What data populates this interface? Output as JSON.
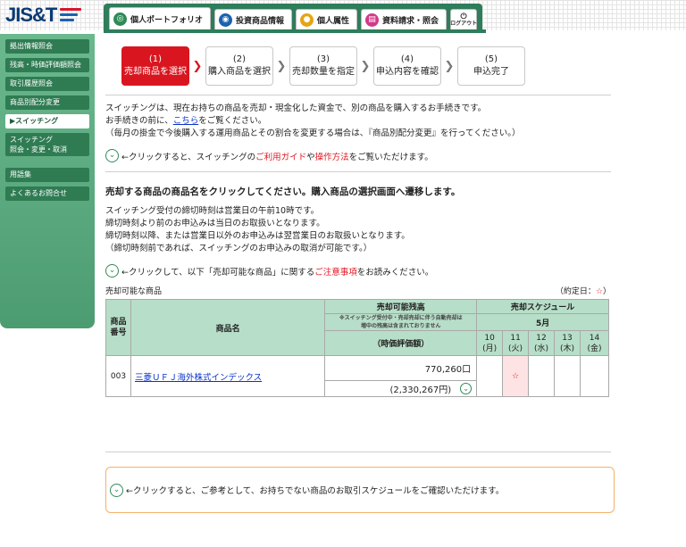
{
  "brand": {
    "logo_text": "JIS&T"
  },
  "tabs": [
    {
      "label": "個人ポートフォリオ",
      "icon": "portfolio-icon",
      "color": "#2e8b57",
      "active": true
    },
    {
      "label": "投資商品情報",
      "icon": "globe-icon",
      "color": "#1b62b0"
    },
    {
      "label": "個人属性",
      "icon": "person-icon",
      "color": "#e6a417"
    },
    {
      "label": "資料請求・照会",
      "icon": "document-icon",
      "color": "#d23a8a"
    }
  ],
  "logout": {
    "label": "ログアウト",
    "icon": "logout-icon"
  },
  "sidebar": {
    "items": [
      {
        "label": "拠出情報照会"
      },
      {
        "label": "残高・時価評価額照会"
      },
      {
        "label": "取引履歴照会"
      },
      {
        "label": "商品別配分変更"
      },
      {
        "label": "▶スイッチング",
        "current": true
      },
      {
        "label": "スイッチング\n照会・変更・取消"
      },
      {
        "label": "用語集"
      },
      {
        "label": "よくあるお問合せ"
      }
    ]
  },
  "steps": [
    {
      "num": "(1)",
      "label": "売却商品を選択",
      "active": true
    },
    {
      "num": "(2)",
      "label": "購入商品を選択"
    },
    {
      "num": "(3)",
      "label": "売却数量を指定"
    },
    {
      "num": "(4)",
      "label": "申込内容を確認"
    },
    {
      "num": "(5)",
      "label": "申込完了"
    }
  ],
  "intro": {
    "line1": "スイッチングは、現在お持ちの商品を売却・現金化した資金で、別の商品を購入するお手続きです。",
    "line2_pre": "お手続きの前に、",
    "line2_link": "こちら",
    "line2_post": "をご覧ください。",
    "line3": "（毎月の掛金で今後購入する運用商品とその割合を変更する場合は、『商品別配分変更』を行ってください。）"
  },
  "guide1": {
    "pre": "←クリックすると、スイッチングの",
    "red1": "ご利用ガイド",
    "mid": "や",
    "red2": "操作方法",
    "post": "をご覧いただけます。"
  },
  "section_heading": "売却する商品の商品名をクリックしてください。購入商品の選択画面へ遷移します。",
  "deadline_text": "スイッチング受付の締切時刻は営業日の午前10時です。\n締切時刻より前のお申込みは当日のお取扱いとなります。\n締切時刻以降、または営業日以外のお申込みは翌営業日のお取扱いとなります。\n（締切時刻前であれば、スイッチングのお申込みの取消が可能です。）",
  "guide2": {
    "pre": "←クリックして、以下「売却可能な商品」に関する",
    "red": "ご注意事項",
    "post": "をお読みください。"
  },
  "list": {
    "title": "売却可能な商品",
    "settle_pre": "（約定日：",
    "settle_mark": "☆",
    "settle_post": "）"
  },
  "table": {
    "h_code": "商品\n番号",
    "h_name": "商品名",
    "h_balance": "売却可能残高",
    "h_balance_note": "※スイッチング受付中・売却売却に伴う自動売却は\n増中の残高は含まれておりません",
    "h_valuation": "（時価評価額）",
    "h_schedule": "売却スケジュール",
    "month": "5月",
    "days": [
      "10\n(月)",
      "11\n(火)",
      "12\n(水)",
      "13\n(木)",
      "14\n(金)"
    ],
    "rows": [
      {
        "code": "003",
        "name": "三菱ＵＦＪ海外株式インデックス",
        "balance": "770,260口",
        "valuation": "(2,330,267円)",
        "star_day_index": 1,
        "star": "☆"
      }
    ]
  },
  "guide3": {
    "text": "←クリックすると、ご参考として、お持ちでない商品のお取引スケジュールをご確認いただけます。"
  },
  "colors": {
    "green": "#2e7d5b",
    "red": "#d9161f",
    "table_header": "#b7dec8",
    "orange_border": "#f4b06a"
  }
}
